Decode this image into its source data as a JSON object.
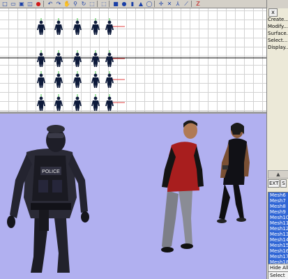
{
  "toolbar": {
    "icons": [
      "new-file-icon",
      "open-file-icon",
      "save-icon",
      "cube-icon",
      "red-sphere-icon",
      "separator",
      "undo-icon",
      "redo-icon",
      "hand-pan-icon",
      "zoom-icon",
      "rotate-icon",
      "zoom-region-icon",
      "separator",
      "select-icon",
      "separator",
      "box-icon",
      "sphere-icon",
      "cylinder-icon",
      "cone-icon",
      "torus-icon",
      "separator",
      "move-icon",
      "scale-icon",
      "axis-icon",
      "bone-icon",
      "separator",
      "z-icon"
    ],
    "glyphs": [
      "□",
      "▭",
      "▣",
      "◫",
      "●",
      "|",
      "↶",
      "↷",
      "✋",
      "⚲",
      "↻",
      "⬚",
      "|",
      "⬚",
      "|",
      "■",
      "●",
      "▮",
      "▲",
      "◯",
      "|",
      "✛",
      "✕",
      "⅄",
      "⟋",
      "|",
      "Z"
    ]
  },
  "panel": {
    "close_label": "x",
    "menu": [
      "Create...",
      "Modify...",
      "Surface...",
      "Select...",
      "Display..."
    ],
    "scroll_arrow": "▲",
    "buttons": [
      "EXT",
      "S"
    ],
    "meshes": [
      "Mesh6",
      "Mesh7",
      "Mesh8",
      "Mesh9",
      "Mesh10",
      "Mesh11",
      "Mesh12",
      "Mesh13",
      "Mesh14",
      "Mesh15",
      "Mesh16",
      "Mesh17",
      "Mesh18"
    ],
    "hide_all": "Hide All",
    "select_all": "Select All"
  },
  "colors": {
    "viewport_top_bg": "#ffffff",
    "grid": "#d2d2d2",
    "viewport_persp_bg": "#b1b0f0",
    "figure": "#0d1a3a",
    "x_axis": "#e04040",
    "y_axis": "#40c040",
    "mesh_list_bg": "#3167d6"
  }
}
